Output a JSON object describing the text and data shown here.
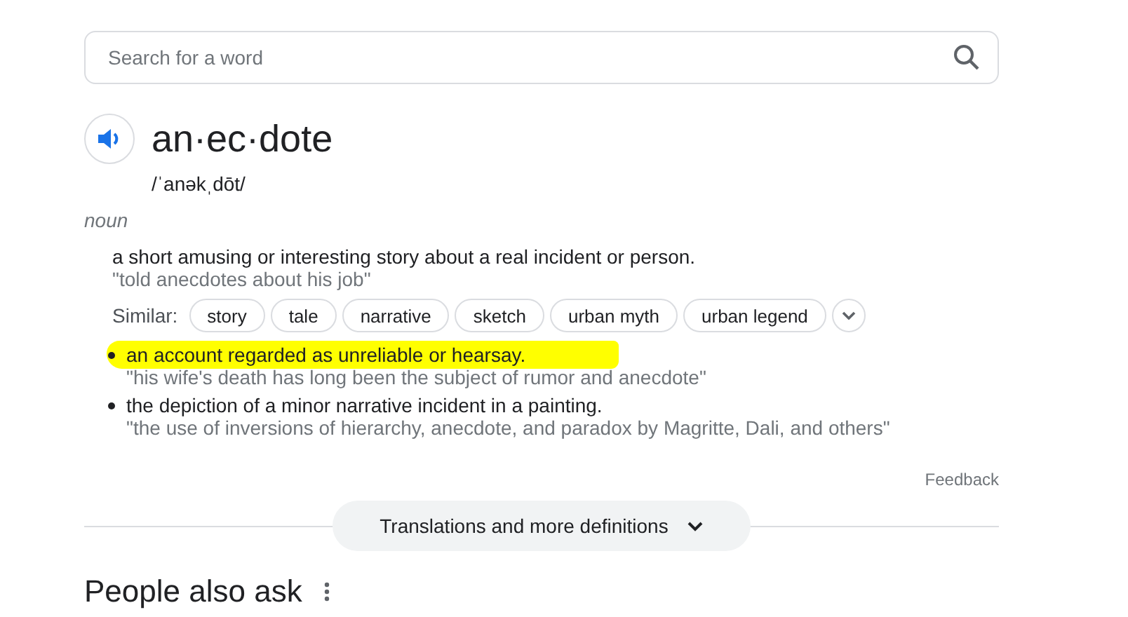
{
  "search": {
    "placeholder": "Search for a word"
  },
  "entry": {
    "word": "an·ec·dote",
    "pronunciation": "/ˈanəkˌdōt/",
    "part_of_speech": "noun",
    "senses": [
      {
        "kind": "plain",
        "highlighted": false,
        "definition": "a short amusing or interesting story about a real incident or person.",
        "example": "\"told anecdotes about his job\"",
        "similar_label": "Similar:",
        "similar": [
          "story",
          "tale",
          "narrative",
          "sketch",
          "urban myth",
          "urban legend"
        ]
      },
      {
        "kind": "bullet",
        "highlighted": true,
        "definition": "an account regarded as unreliable or hearsay.",
        "example": "\"his wife's death has long been the subject of rumor and anecdote\""
      },
      {
        "kind": "bullet",
        "highlighted": false,
        "definition": "the depiction of a minor narrative incident in a painting.",
        "example": "\"the use of inversions of hierarchy, anecdote, and paradox by Magritte, Dali, and others\""
      }
    ]
  },
  "feedback": "Feedback",
  "more_button": "Translations and more definitions",
  "people_also_ask": "People also ask"
}
